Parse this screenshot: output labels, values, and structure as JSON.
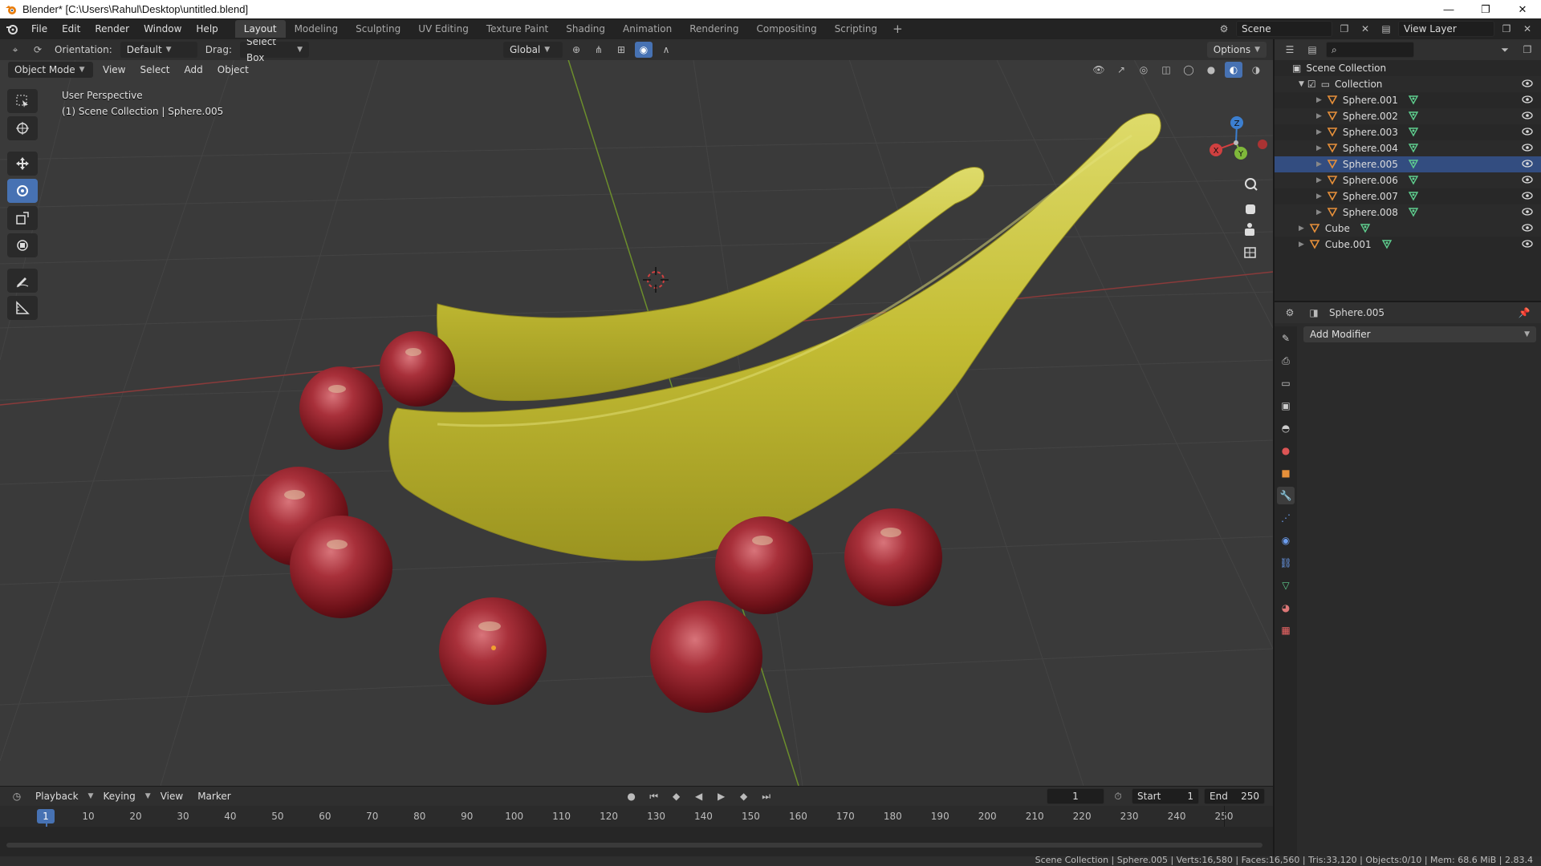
{
  "window": {
    "title": "Blender* [C:\\Users\\Rahul\\Desktop\\untitled.blend]",
    "controls": [
      "—",
      "❐",
      "✕"
    ]
  },
  "menubar": {
    "items": [
      "File",
      "Edit",
      "Render",
      "Window",
      "Help"
    ],
    "workspaces": [
      "Layout",
      "Modeling",
      "Sculpting",
      "UV Editing",
      "Texture Paint",
      "Shading",
      "Animation",
      "Rendering",
      "Compositing",
      "Scripting"
    ],
    "active_workspace": "Layout",
    "add_workspace": "+",
    "scene": "Scene",
    "view_layer": "View Layer"
  },
  "viewport_header": {
    "orientation_label": "Orientation:",
    "orientation_value": "Default",
    "drag_label": "Drag:",
    "drag_value": "Select Box",
    "transform_orientation": "Global",
    "options": "Options",
    "mode": "Object Mode",
    "menus": [
      "View",
      "Select",
      "Add",
      "Object"
    ]
  },
  "viewport_overlay": {
    "perspective": "User Perspective",
    "context": "(1) Scene Collection | Sphere.005"
  },
  "gizmo": {
    "z": "Z",
    "y": "Y",
    "x": "X"
  },
  "outliner": {
    "root": "Scene Collection",
    "collection": "Collection",
    "items": [
      {
        "name": "Sphere.001",
        "selected": false
      },
      {
        "name": "Sphere.002",
        "selected": false
      },
      {
        "name": "Sphere.003",
        "selected": false
      },
      {
        "name": "Sphere.004",
        "selected": false
      },
      {
        "name": "Sphere.005",
        "selected": true
      },
      {
        "name": "Sphere.006",
        "selected": false
      },
      {
        "name": "Sphere.007",
        "selected": false
      },
      {
        "name": "Sphere.008",
        "selected": false
      }
    ],
    "top_level": [
      "Cube",
      "Cube.001"
    ]
  },
  "properties": {
    "object_name": "Sphere.005",
    "add_modifier": "Add Modifier"
  },
  "timeline": {
    "menus": [
      "Playback",
      "Keying",
      "View",
      "Marker"
    ],
    "current_frame": "1",
    "start_label": "Start",
    "start": "1",
    "end_label": "End",
    "end": "250",
    "ticks": [
      "1",
      "10",
      "20",
      "30",
      "40",
      "50",
      "60",
      "70",
      "80",
      "90",
      "100",
      "110",
      "120",
      "130",
      "140",
      "150",
      "160",
      "170",
      "180",
      "190",
      "200",
      "210",
      "220",
      "230",
      "240",
      "250"
    ]
  },
  "statusbar": {
    "stats": "Scene Collection | Sphere.005 | Verts:16,580 | Faces:16,560 | Tris:33,120 | Objects:0/10 | Mem: 68.6 MiB | 2.83.4"
  },
  "colors": {
    "accent": "#4772b3",
    "viewport_bg": "#393939",
    "banana": "#c8c23a",
    "apple": "#8e1c24",
    "axis_x": "#d04040",
    "axis_y": "#7fb83a"
  }
}
